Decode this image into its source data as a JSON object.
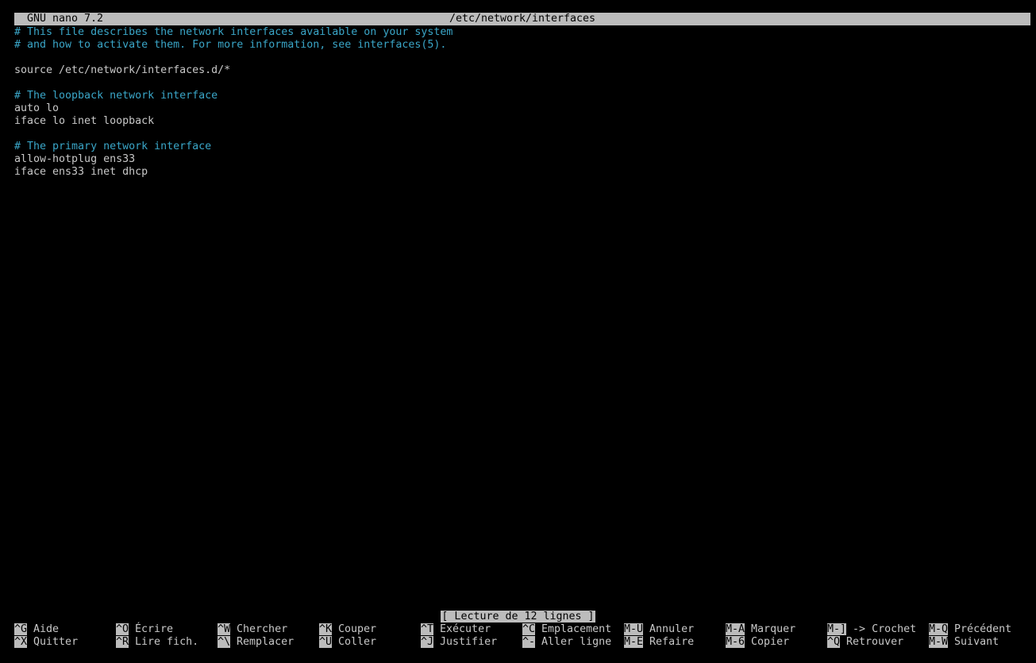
{
  "titlebar": {
    "app": "GNU nano 7.2",
    "filename": "/etc/network/interfaces"
  },
  "editor": {
    "lines": [
      {
        "text": "# This file describes the network interfaces available on your system",
        "kind": "comment"
      },
      {
        "text": "# and how to activate them. For more information, see interfaces(5).",
        "kind": "comment"
      },
      {
        "text": "",
        "kind": "code"
      },
      {
        "text": "source /etc/network/interfaces.d/*",
        "kind": "code"
      },
      {
        "text": "",
        "kind": "code"
      },
      {
        "text": "# The loopback network interface",
        "kind": "comment"
      },
      {
        "text": "auto lo",
        "kind": "code"
      },
      {
        "text": "iface lo inet loopback",
        "kind": "code"
      },
      {
        "text": "",
        "kind": "code"
      },
      {
        "text": "# The primary network interface",
        "kind": "comment"
      },
      {
        "text": "allow-hotplug ens33",
        "kind": "code"
      },
      {
        "text": "iface ens33 inet dhcp",
        "kind": "code"
      }
    ]
  },
  "status": {
    "message": "[ Lecture de 12 lignes ]"
  },
  "shortcuts": {
    "row1": [
      {
        "key": "^G",
        "label": "Aide"
      },
      {
        "key": "^O",
        "label": "Écrire"
      },
      {
        "key": "^W",
        "label": "Chercher"
      },
      {
        "key": "^K",
        "label": "Couper"
      },
      {
        "key": "^T",
        "label": "Exécuter"
      },
      {
        "key": "^C",
        "label": "Emplacement"
      },
      {
        "key": "M-U",
        "label": "Annuler"
      },
      {
        "key": "M-A",
        "label": "Marquer"
      },
      {
        "key": "M-]",
        "label": "-> Crochet"
      },
      {
        "key": "M-Q",
        "label": "Précédent"
      }
    ],
    "row2": [
      {
        "key": "^X",
        "label": "Quitter"
      },
      {
        "key": "^R",
        "label": "Lire fich."
      },
      {
        "key": "^\\",
        "label": "Remplacer"
      },
      {
        "key": "^U",
        "label": "Coller"
      },
      {
        "key": "^J",
        "label": "Justifier"
      },
      {
        "key": "^-",
        "label": "Aller ligne"
      },
      {
        "key": "M-E",
        "label": "Refaire"
      },
      {
        "key": "M-6",
        "label": "Copier"
      },
      {
        "key": "^Q",
        "label": "Retrouver"
      },
      {
        "key": "M-W",
        "label": "Suivant"
      }
    ]
  }
}
